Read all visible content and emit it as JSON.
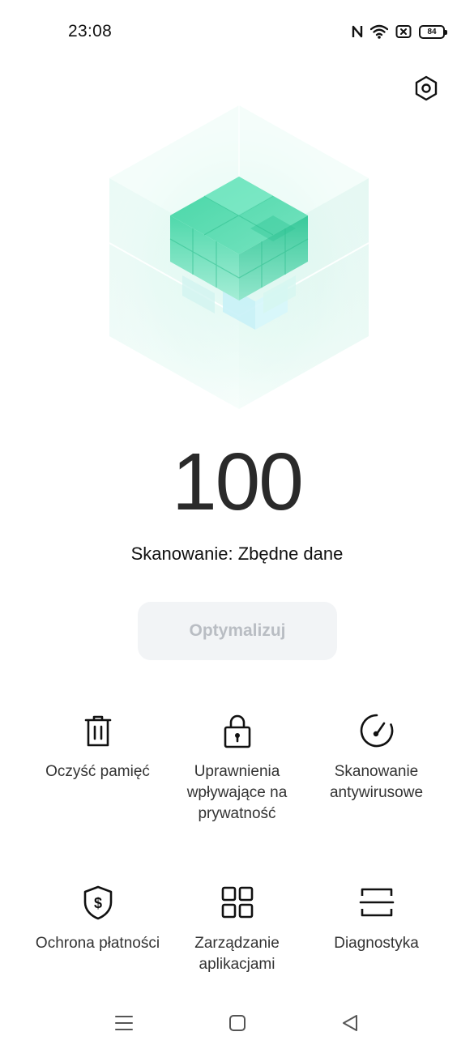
{
  "status_bar": {
    "time": "23:08",
    "battery_level": "84",
    "icons": [
      "nfc-icon",
      "wifi-icon",
      "sim-off-icon",
      "battery-icon"
    ]
  },
  "header": {
    "settings_icon": "hexagon-settings-icon"
  },
  "hero": {
    "illustration": "green-cube-illustration",
    "colors": {
      "accent": "#3fd3a3",
      "glow": "#d8f7ee"
    }
  },
  "main": {
    "score": "100",
    "scan_status": "Skanowanie: Zbędne dane",
    "optimize_label": "Optymalizuj"
  },
  "tools": [
    {
      "id": "clean-memory",
      "icon": "trash-icon",
      "label": "Oczyść pamięć"
    },
    {
      "id": "privacy-permissions",
      "icon": "padlock-icon",
      "label": "Uprawnienia\nwpływające na\nprywatność"
    },
    {
      "id": "antivirus-scan",
      "icon": "gauge-icon",
      "label": "Skanowanie\nantywirusowe"
    },
    {
      "id": "payment-protection",
      "icon": "shield-dollar-icon",
      "label": "Ochrona płatności"
    },
    {
      "id": "app-management",
      "icon": "grid-apps-icon",
      "label": "Zarządzanie\naplikacjami"
    },
    {
      "id": "diagnostics",
      "icon": "scan-frame-icon",
      "label": "Diagnostyka"
    }
  ],
  "nav_bar": {
    "buttons": [
      "menu-icon",
      "home-icon",
      "back-icon"
    ]
  }
}
